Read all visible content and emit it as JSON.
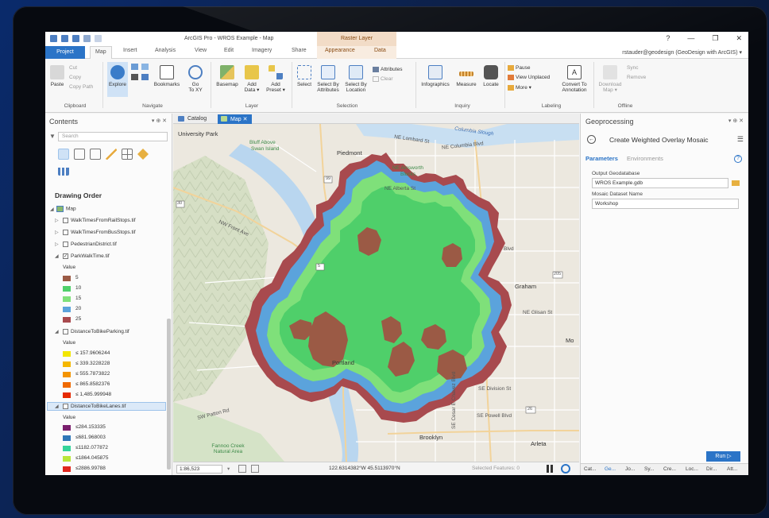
{
  "app": {
    "title": "ArcGIS Pro - WROS Example - Map",
    "context_header": "Raster Layer",
    "window_controls": [
      "?",
      "—",
      "❐",
      "✕"
    ],
    "user": "rstauder@geodesign (GeoDesign with ArcGIS) ▾"
  },
  "tabs": [
    "Project",
    "Map",
    "Insert",
    "Analysis",
    "View",
    "Edit",
    "Imagery",
    "Share",
    "Appearance",
    "Data"
  ],
  "ribbon": {
    "clipboard": {
      "paste": "Paste",
      "cut": "Cut",
      "copy": "Copy",
      "copy_path": "Copy Path",
      "label": "Clipboard"
    },
    "navigate": {
      "explore": "Explore",
      "bookmarks": "Bookmarks",
      "goto_line1": "Go",
      "goto_line2": "To XY",
      "label": "Navigate"
    },
    "layer": {
      "basemap": "Basemap",
      "add_data_1": "Add",
      "add_data_2": "Data ▾",
      "add_preset_1": "Add",
      "add_preset_2": "Preset ▾",
      "label": "Layer"
    },
    "selection": {
      "select": "Select",
      "sba_1": "Select By",
      "sba_2": "Attributes",
      "sbl_1": "Select By",
      "sbl_2": "Location",
      "attributes": "Attributes",
      "clear": "Clear",
      "label": "Selection"
    },
    "inquiry": {
      "infographics": "Infographics",
      "measure": "Measure",
      "locate": "Locate",
      "label": "Inquiry"
    },
    "labeling": {
      "pause": "Pause",
      "view_unplaced": "View Unplaced",
      "more": "More ▾",
      "convert_1": "Convert To",
      "convert_2": "Annotation",
      "label": "Labeling"
    },
    "offline": {
      "download_1": "Download",
      "download_2": "Map ▾",
      "sync": "Sync",
      "remove": "Remove",
      "label": "Offline"
    }
  },
  "contents": {
    "title": "Contents",
    "controls": "▾ ⊕ ✕",
    "search_placeholder": "Search",
    "drawing_order": "Drawing Order",
    "map_layer": "Map",
    "layers": [
      {
        "name": "WalkTimesFromRailStops.tif",
        "checked": false
      },
      {
        "name": "WalkTimesFromBusStops.tif",
        "checked": false
      },
      {
        "name": "PedestrianDistrict.tif",
        "checked": false
      },
      {
        "name": "ParkWalkTime.tif",
        "checked": true
      }
    ],
    "value_label": "Value",
    "park_legend": [
      {
        "label": "5",
        "color": "#9b5a45"
      },
      {
        "label": "10",
        "color": "#4fcf6a"
      },
      {
        "label": "15",
        "color": "#7fe07a"
      },
      {
        "label": "20",
        "color": "#5ba3dc"
      },
      {
        "label": "25",
        "color": "#a84a4e"
      }
    ],
    "parking_layer": "DistanceToBikeParking.tif",
    "parking_legend": [
      {
        "label": "≤ 157.9606244",
        "color": "#f2e600"
      },
      {
        "label": "≤ 339.3228228",
        "color": "#f5b800"
      },
      {
        "label": "≤ 555.7873822",
        "color": "#f39400"
      },
      {
        "label": "≤ 865.8582376",
        "color": "#ef6a00"
      },
      {
        "label": "≤ 1,485.999948",
        "color": "#e52a00"
      }
    ],
    "bikelanes_layer": "DistanceToBikeLanes.tif",
    "bikelanes_legend": [
      {
        "label": "≤284.153335",
        "color": "#7a1f6e"
      },
      {
        "label": "≤681.968003",
        "color": "#2f77b8"
      },
      {
        "label": "≤1182.077872",
        "color": "#35d49a"
      },
      {
        "label": "≤1864.045875",
        "color": "#b9e63a"
      },
      {
        "label": "≤2886.99788",
        "color": "#e0261d"
      }
    ]
  },
  "view_tabs": {
    "catalog": "Catalog",
    "map": "Map",
    "close": "✕"
  },
  "map": {
    "labels": {
      "university_park": "University Park",
      "columbia_slough": "Columbia Slough",
      "ne_lombard": "NE Lombard St",
      "ne_columbia": "NE Columbia Blvd",
      "bluff": "Bluff Above",
      "swan_island": "Swan Island",
      "piedmont": "Piedmont",
      "ne_ainsworth": "NE Ainsworth",
      "blocks": "Blocks",
      "ne_alberta": "NE Alberta St",
      "nw_front": "NW Front Ave",
      "graham": "Graham",
      "ne_glisan": "NE Glisan St",
      "portland": "Portland",
      "mo": "Mo",
      "se_division": "SE Division St",
      "sw_patton": "SW Patton Rd",
      "se_powell": "SE Powell Blvd",
      "se_cesar": "SE Cesar E Chavez Blvd",
      "brooklyn": "Brooklyn",
      "arleta": "Arleta",
      "forest_park": "Fannoo Creek Natural Area",
      "blvd": "Blvd",
      "route_30": "30",
      "route_205": "205",
      "route_26": "26",
      "route_5": "5",
      "route_99": "99"
    },
    "scale": "1:86,523",
    "coordinates": "122.6314382°W 45.5113970°N",
    "selected_features": "Selected Features: 0"
  },
  "geoprocessing": {
    "title": "Geoprocessing",
    "controls": "▾ ⊕ ✕",
    "tool_name": "Create Weighted Overlay Mosaic",
    "tab_parameters": "Parameters",
    "tab_environments": "Environments",
    "output_label": "Output Geodatabase",
    "output_value": "WROS Example.gdb",
    "mosaic_label": "Mosaic Dataset Name",
    "mosaic_value": "Workshop",
    "run": "Run",
    "bottom_tabs": [
      "Cat...",
      "Ge...",
      "Jo...",
      "Sy...",
      "Cre...",
      "Loc...",
      "Dir...",
      "Att..."
    ]
  }
}
